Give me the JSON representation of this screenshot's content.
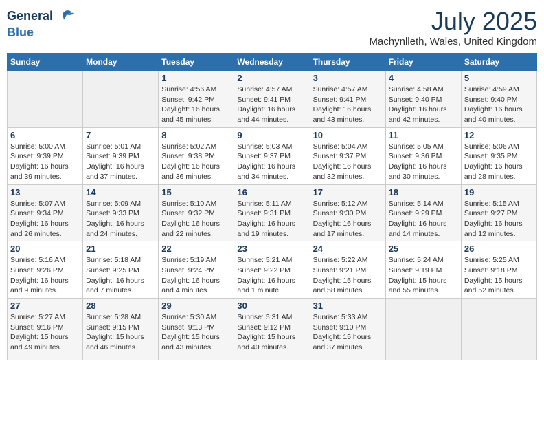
{
  "logo": {
    "line1": "General",
    "line2": "Blue"
  },
  "title": {
    "month_year": "July 2025",
    "location": "Machynlleth, Wales, United Kingdom"
  },
  "days_of_week": [
    "Sunday",
    "Monday",
    "Tuesday",
    "Wednesday",
    "Thursday",
    "Friday",
    "Saturday"
  ],
  "weeks": [
    [
      {
        "day": "",
        "info": ""
      },
      {
        "day": "",
        "info": ""
      },
      {
        "day": "1",
        "info": "Sunrise: 4:56 AM\nSunset: 9:42 PM\nDaylight: 16 hours\nand 45 minutes."
      },
      {
        "day": "2",
        "info": "Sunrise: 4:57 AM\nSunset: 9:41 PM\nDaylight: 16 hours\nand 44 minutes."
      },
      {
        "day": "3",
        "info": "Sunrise: 4:57 AM\nSunset: 9:41 PM\nDaylight: 16 hours\nand 43 minutes."
      },
      {
        "day": "4",
        "info": "Sunrise: 4:58 AM\nSunset: 9:40 PM\nDaylight: 16 hours\nand 42 minutes."
      },
      {
        "day": "5",
        "info": "Sunrise: 4:59 AM\nSunset: 9:40 PM\nDaylight: 16 hours\nand 40 minutes."
      }
    ],
    [
      {
        "day": "6",
        "info": "Sunrise: 5:00 AM\nSunset: 9:39 PM\nDaylight: 16 hours\nand 39 minutes."
      },
      {
        "day": "7",
        "info": "Sunrise: 5:01 AM\nSunset: 9:39 PM\nDaylight: 16 hours\nand 37 minutes."
      },
      {
        "day": "8",
        "info": "Sunrise: 5:02 AM\nSunset: 9:38 PM\nDaylight: 16 hours\nand 36 minutes."
      },
      {
        "day": "9",
        "info": "Sunrise: 5:03 AM\nSunset: 9:37 PM\nDaylight: 16 hours\nand 34 minutes."
      },
      {
        "day": "10",
        "info": "Sunrise: 5:04 AM\nSunset: 9:37 PM\nDaylight: 16 hours\nand 32 minutes."
      },
      {
        "day": "11",
        "info": "Sunrise: 5:05 AM\nSunset: 9:36 PM\nDaylight: 16 hours\nand 30 minutes."
      },
      {
        "day": "12",
        "info": "Sunrise: 5:06 AM\nSunset: 9:35 PM\nDaylight: 16 hours\nand 28 minutes."
      }
    ],
    [
      {
        "day": "13",
        "info": "Sunrise: 5:07 AM\nSunset: 9:34 PM\nDaylight: 16 hours\nand 26 minutes."
      },
      {
        "day": "14",
        "info": "Sunrise: 5:09 AM\nSunset: 9:33 PM\nDaylight: 16 hours\nand 24 minutes."
      },
      {
        "day": "15",
        "info": "Sunrise: 5:10 AM\nSunset: 9:32 PM\nDaylight: 16 hours\nand 22 minutes."
      },
      {
        "day": "16",
        "info": "Sunrise: 5:11 AM\nSunset: 9:31 PM\nDaylight: 16 hours\nand 19 minutes."
      },
      {
        "day": "17",
        "info": "Sunrise: 5:12 AM\nSunset: 9:30 PM\nDaylight: 16 hours\nand 17 minutes."
      },
      {
        "day": "18",
        "info": "Sunrise: 5:14 AM\nSunset: 9:29 PM\nDaylight: 16 hours\nand 14 minutes."
      },
      {
        "day": "19",
        "info": "Sunrise: 5:15 AM\nSunset: 9:27 PM\nDaylight: 16 hours\nand 12 minutes."
      }
    ],
    [
      {
        "day": "20",
        "info": "Sunrise: 5:16 AM\nSunset: 9:26 PM\nDaylight: 16 hours\nand 9 minutes."
      },
      {
        "day": "21",
        "info": "Sunrise: 5:18 AM\nSunset: 9:25 PM\nDaylight: 16 hours\nand 7 minutes."
      },
      {
        "day": "22",
        "info": "Sunrise: 5:19 AM\nSunset: 9:24 PM\nDaylight: 16 hours\nand 4 minutes."
      },
      {
        "day": "23",
        "info": "Sunrise: 5:21 AM\nSunset: 9:22 PM\nDaylight: 16 hours\nand 1 minute."
      },
      {
        "day": "24",
        "info": "Sunrise: 5:22 AM\nSunset: 9:21 PM\nDaylight: 15 hours\nand 58 minutes."
      },
      {
        "day": "25",
        "info": "Sunrise: 5:24 AM\nSunset: 9:19 PM\nDaylight: 15 hours\nand 55 minutes."
      },
      {
        "day": "26",
        "info": "Sunrise: 5:25 AM\nSunset: 9:18 PM\nDaylight: 15 hours\nand 52 minutes."
      }
    ],
    [
      {
        "day": "27",
        "info": "Sunrise: 5:27 AM\nSunset: 9:16 PM\nDaylight: 15 hours\nand 49 minutes."
      },
      {
        "day": "28",
        "info": "Sunrise: 5:28 AM\nSunset: 9:15 PM\nDaylight: 15 hours\nand 46 minutes."
      },
      {
        "day": "29",
        "info": "Sunrise: 5:30 AM\nSunset: 9:13 PM\nDaylight: 15 hours\nand 43 minutes."
      },
      {
        "day": "30",
        "info": "Sunrise: 5:31 AM\nSunset: 9:12 PM\nDaylight: 15 hours\nand 40 minutes."
      },
      {
        "day": "31",
        "info": "Sunrise: 5:33 AM\nSunset: 9:10 PM\nDaylight: 15 hours\nand 37 minutes."
      },
      {
        "day": "",
        "info": ""
      },
      {
        "day": "",
        "info": ""
      }
    ]
  ]
}
